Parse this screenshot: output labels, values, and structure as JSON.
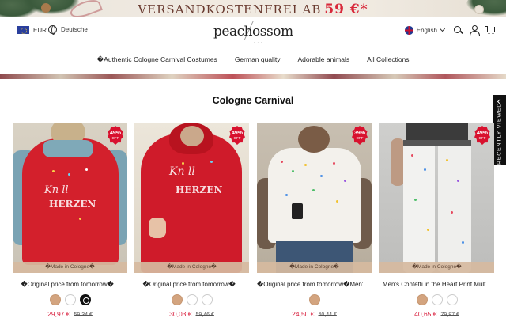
{
  "promo": {
    "text": "VERSANDKOSTENFREI AB",
    "amount": "59 €*"
  },
  "header": {
    "currency": "EUR",
    "country_language": "Deutsche",
    "logo_text": "peachossom",
    "language": "English",
    "icons": [
      "eu-flag-icon",
      "globe-icon",
      "uk-flag-icon",
      "chevron-down-icon",
      "search-icon",
      "user-icon",
      "cart-icon"
    ]
  },
  "nav": {
    "items": [
      {
        "label": "�Authentic Cologne Carnival Costumes"
      },
      {
        "label": "German quality"
      },
      {
        "label": "Adorable animals"
      },
      {
        "label": "All Collections"
      }
    ]
  },
  "section": {
    "title": "Cologne Carnival"
  },
  "recently_viewed": {
    "label": "RECENTLY VIEWED"
  },
  "colors": {
    "sale_red": "#d81b3a",
    "badge_red": "#d8112e",
    "made_tag": "#d6baa0",
    "tan_swatch": "#d3a47f"
  },
  "products": [
    {
      "badge_pct": "49%",
      "badge_off": "OFF",
      "made_tag": "�Made in Cologne�",
      "name": "�Original price from tomorrow�...",
      "price": "29,97 €",
      "old_price": "59,34 €",
      "swatches": [
        "tan",
        "white",
        "dark"
      ]
    },
    {
      "badge_pct": "49%",
      "badge_off": "OFF",
      "made_tag": "�Made in Cologne�",
      "name": "�Original price from tomorrow�...",
      "price": "30,03 €",
      "old_price": "59,46 €",
      "swatches": [
        "tan",
        "white",
        "white"
      ]
    },
    {
      "badge_pct": "39%",
      "badge_off": "OFF",
      "made_tag": "�Made in Cologne�",
      "name": "�Original price from tomorrow�Men's...",
      "price": "24,50 €",
      "old_price": "40,44 €",
      "swatches": [
        "tan"
      ]
    },
    {
      "badge_pct": "49%",
      "badge_off": "OFF",
      "made_tag": "�Made in Cologne�",
      "name": "Men's Confetti in the Heart Print Mult...",
      "price": "40,65 €",
      "old_price": "79,87 €",
      "swatches": [
        "tan",
        "white",
        "white"
      ]
    }
  ]
}
